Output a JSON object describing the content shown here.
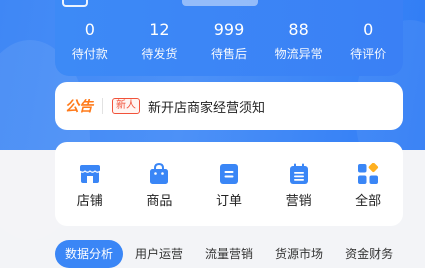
{
  "stats": [
    {
      "value": "0",
      "label": "待付款"
    },
    {
      "value": "12",
      "label": "待发货"
    },
    {
      "value": "999",
      "label": "待售后"
    },
    {
      "value": "88",
      "label": "物流异常"
    },
    {
      "value": "0",
      "label": "待评价"
    }
  ],
  "notice": {
    "label": "公告",
    "tag": "新人",
    "text": "新开店商家经营须知"
  },
  "menu": [
    {
      "label": "店铺",
      "icon": "store-icon"
    },
    {
      "label": "商品",
      "icon": "shopping-bag-icon"
    },
    {
      "label": "订单",
      "icon": "order-icon"
    },
    {
      "label": "营销",
      "icon": "marketing-icon"
    },
    {
      "label": "全部",
      "icon": "all-apps-icon"
    }
  ],
  "tabs": [
    {
      "label": "数据分析",
      "active": true
    },
    {
      "label": "用户运营",
      "active": false
    },
    {
      "label": "流量营销",
      "active": false
    },
    {
      "label": "货源市场",
      "active": false
    },
    {
      "label": "资金财务",
      "active": false
    }
  ],
  "colors": {
    "primary_blue": "#3a86f6",
    "notice_orange": "#ff7a1a",
    "tag_red": "#f1523a"
  }
}
